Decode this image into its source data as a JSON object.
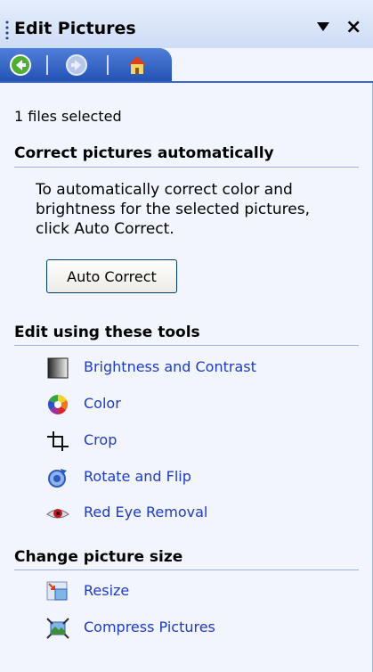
{
  "pane": {
    "title": "Edit Pictures",
    "dropdown_icon": "dropdown-arrow-icon",
    "close_icon": "close-icon"
  },
  "nav": {
    "back_icon": "back-arrow-icon",
    "forward_icon": "forward-arrow-icon",
    "home_icon": "home-icon"
  },
  "status": "1 files selected",
  "auto_correct": {
    "heading": "Correct pictures automatically",
    "description": "To automatically correct color and brightness for the selected pictures, click Auto Correct.",
    "button_label": "Auto Correct"
  },
  "tools": {
    "heading": "Edit using these tools",
    "items": [
      {
        "label": "Brightness and Contrast",
        "icon": "brightness-contrast-icon"
      },
      {
        "label": "Color",
        "icon": "color-wheel-icon"
      },
      {
        "label": "Crop",
        "icon": "crop-icon"
      },
      {
        "label": "Rotate and Flip",
        "icon": "rotate-flip-icon"
      },
      {
        "label": "Red Eye Removal",
        "icon": "red-eye-icon"
      }
    ]
  },
  "size": {
    "heading": "Change picture size",
    "items": [
      {
        "label": "Resize",
        "icon": "resize-icon"
      },
      {
        "label": "Compress Pictures",
        "icon": "compress-pictures-icon"
      }
    ]
  },
  "colors": {
    "link": "#1d3bc4",
    "nav_bar": "#2351b4",
    "pane_background": "#f2f5fd",
    "section_rule": "#9bb3e0"
  }
}
